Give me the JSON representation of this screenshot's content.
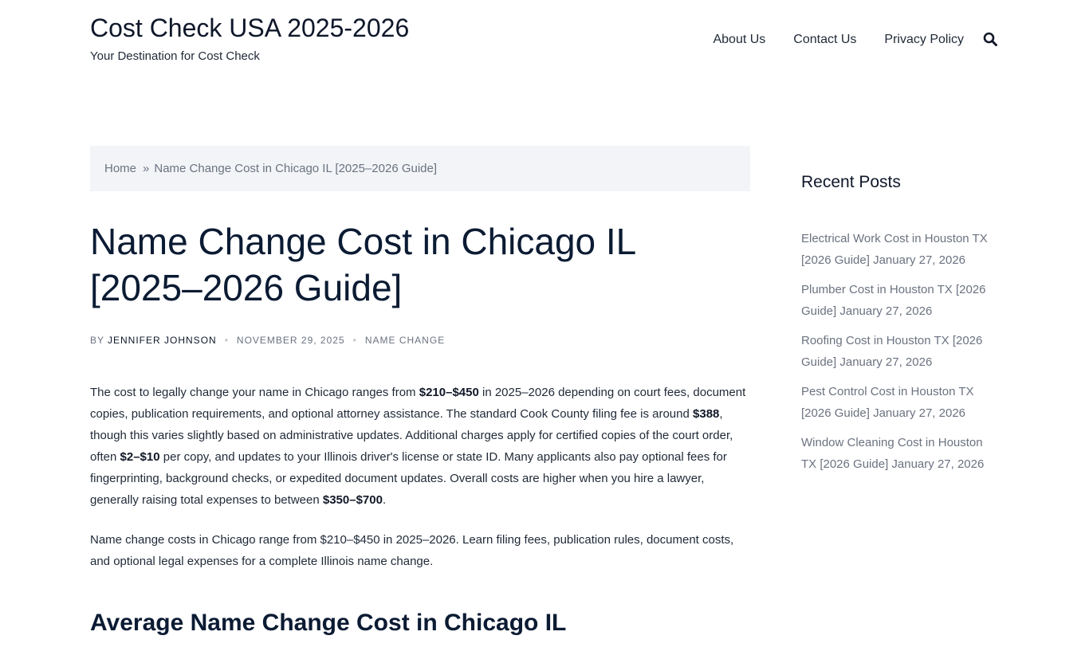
{
  "site": {
    "title": "Cost Check USA 2025-2026",
    "tagline": "Your Destination for Cost Check"
  },
  "nav": {
    "items": [
      "About Us",
      "Contact Us",
      "Privacy Policy"
    ],
    "search_icon": "search-icon"
  },
  "breadcrumb": {
    "home": "Home",
    "separator": "»",
    "current": "Name Change Cost in Chicago IL [2025–2026 Guide]"
  },
  "post": {
    "title": "Name Change Cost in Chicago IL [2025–2026 Guide]",
    "meta": {
      "by": "BY",
      "author": "JENNIFER JOHNSON",
      "date": "NOVEMBER 29, 2025",
      "category": "NAME CHANGE"
    },
    "paragraph1": {
      "t1": "The cost to legally change your name in Chicago ranges from ",
      "b1": "$210–$450",
      "t2": " in 2025–2026 depending on court fees, document copies, publication requirements, and optional attorney assistance. The standard Cook County filing fee is around ",
      "b2": "$388",
      "t3": ", though this varies slightly based on administrative updates. Additional charges apply for certified copies of the court order, often ",
      "b3": "$2–$10",
      "t4": " per copy, and updates to your Illinois driver's license or state ID. Many applicants also pay optional fees for fingerprinting, background checks, or expedited document updates. Overall costs are higher when you hire a lawyer, generally raising total expenses to between ",
      "b4": "$350–$700",
      "t5": "."
    },
    "paragraph2": "Name change costs in Chicago range from $210–$450 in 2025–2026. Learn filing fees, publication rules, document costs, and optional legal expenses for a complete Illinois name change.",
    "heading2": "Average Name Change Cost in Chicago IL"
  },
  "sidebar": {
    "heading": "Recent Posts",
    "posts": [
      {
        "title": "Electrical Work Cost in Houston TX [2026 Guide]",
        "date": "January 27, 2026"
      },
      {
        "title": "Plumber Cost in Houston TX [2026 Guide]",
        "date": "January 27, 2026"
      },
      {
        "title": "Roofing Cost in Houston TX [2026 Guide]",
        "date": "January 27, 2026"
      },
      {
        "title": "Pest Control Cost in Houston TX [2026 Guide]",
        "date": "January 27, 2026"
      },
      {
        "title": "Window Cleaning Cost in Houston TX [2026 Guide]",
        "date": "January 27, 2026"
      }
    ]
  }
}
